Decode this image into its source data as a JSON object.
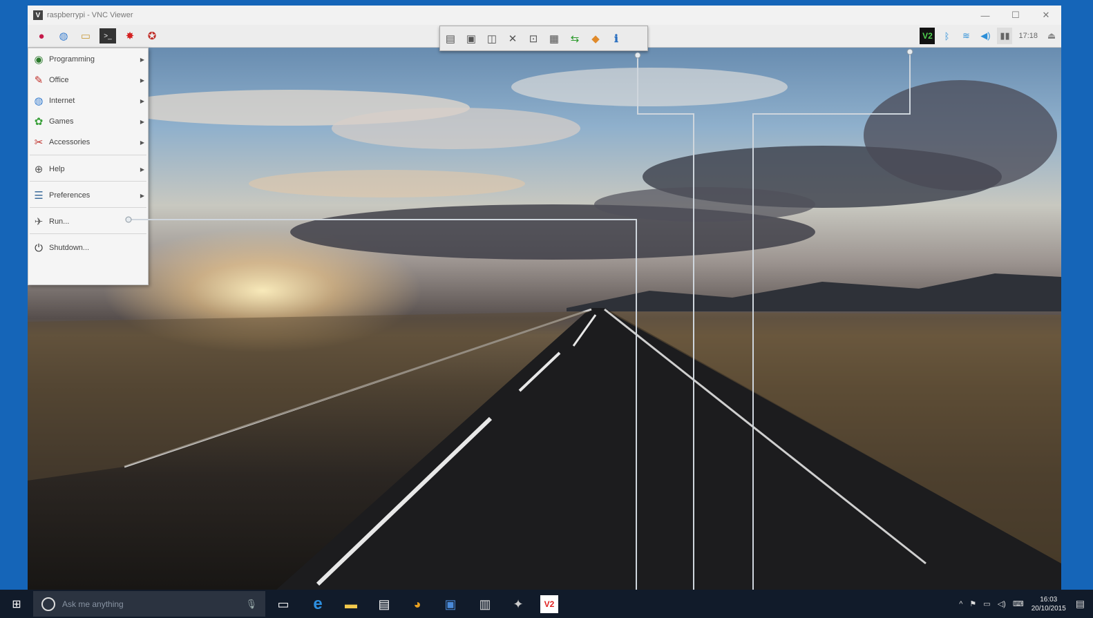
{
  "window": {
    "title": "raspberrypi - VNC Viewer",
    "minimize": "—",
    "maximize": "☐",
    "close": "✕"
  },
  "pi_panel": {
    "launchers": [
      {
        "icon": "raspberry-icon",
        "glyph": "●",
        "color": "#c51a4a"
      },
      {
        "icon": "globe-icon",
        "glyph": "◍",
        "color": "#3a7fd0"
      },
      {
        "icon": "folder-icon",
        "glyph": "▭",
        "color": "#c89a3a"
      },
      {
        "icon": "terminal-icon",
        "glyph": ">_",
        "color": "#333333"
      },
      {
        "icon": "math-icon",
        "glyph": "✸",
        "color": "#d42020"
      },
      {
        "icon": "wolfram-icon",
        "glyph": "✪",
        "color": "#c0302a"
      }
    ],
    "tray": {
      "vnc": "V2",
      "bluetooth": "ᛒ",
      "wifi": "≋",
      "volume": "◀)",
      "cpu": "▮▮",
      "clock": "17:18",
      "eject": "⏏"
    }
  },
  "vnc_toolbar": [
    {
      "icon": "display-icon",
      "glyph": "▤"
    },
    {
      "icon": "save-icon",
      "glyph": "▣"
    },
    {
      "icon": "screens-icon",
      "glyph": "◫"
    },
    {
      "icon": "tools-icon",
      "glyph": "✕"
    },
    {
      "icon": "zoom-icon",
      "glyph": "⊡"
    },
    {
      "icon": "options-icon",
      "glyph": "▦"
    },
    {
      "icon": "transfer-icon",
      "glyph": "⇆",
      "color": "#2a9a2a"
    },
    {
      "icon": "chat-icon",
      "glyph": "◆",
      "color": "#e08a2a"
    },
    {
      "icon": "info-icon",
      "glyph": "ℹ",
      "color": "#2a6fc0"
    }
  ],
  "app_menu": [
    {
      "label": "Programming",
      "icon": "programming-icon",
      "glyph": "◉",
      "color": "#2c7a2c",
      "submenu": true
    },
    {
      "label": "Office",
      "icon": "office-icon",
      "glyph": "✎",
      "color": "#c0302a",
      "submenu": true
    },
    {
      "label": "Internet",
      "icon": "internet-icon",
      "glyph": "◍",
      "color": "#3a7fd0",
      "submenu": true
    },
    {
      "label": "Games",
      "icon": "games-icon",
      "glyph": "✿",
      "color": "#3aa03a",
      "submenu": true
    },
    {
      "label": "Accessories",
      "icon": "accessories-icon",
      "glyph": "✂",
      "color": "#c0302a",
      "submenu": true
    },
    {
      "label": "Help",
      "icon": "help-icon",
      "glyph": "⊕",
      "color": "#555555",
      "submenu": true
    },
    {
      "label": "Preferences",
      "icon": "preferences-icon",
      "glyph": "☰",
      "color": "#3a6a9a",
      "submenu": true
    },
    {
      "label": "Run...",
      "icon": "run-icon",
      "glyph": "✈",
      "color": "#666666",
      "submenu": false
    },
    {
      "label": "Shutdown...",
      "icon": "shutdown-icon",
      "glyph": "⏻",
      "color": "#333333",
      "submenu": false
    }
  ],
  "windows_taskbar": {
    "start": "⊞",
    "search_placeholder": "Ask me anything",
    "mic": "🎙",
    "apps": [
      {
        "icon": "task-view-icon",
        "glyph": "▭",
        "color": "#ffffff"
      },
      {
        "icon": "edge-icon",
        "glyph": "e",
        "color": "#2d8fe0"
      },
      {
        "icon": "file-explorer-icon",
        "glyph": "▬",
        "color": "#f2c94c"
      },
      {
        "icon": "store-icon",
        "glyph": "▤",
        "color": "#ffffff"
      },
      {
        "icon": "chrome-icon",
        "glyph": "◕",
        "color": "#e8a020"
      },
      {
        "icon": "remote-desktop-icon",
        "glyph": "▣",
        "color": "#4a8ad8"
      },
      {
        "icon": "document-icon",
        "glyph": "▥",
        "color": "#dddddd"
      },
      {
        "icon": "settings-app-icon",
        "glyph": "✦",
        "color": "#cccccc"
      },
      {
        "icon": "vnc-viewer-icon",
        "glyph": "V2",
        "color": "#e02020"
      }
    ],
    "tray": [
      "^",
      "⚑",
      "▭",
      "◁)",
      "⌨"
    ],
    "time": "16:03",
    "date": "20/10/2015",
    "notifications": "▤"
  }
}
